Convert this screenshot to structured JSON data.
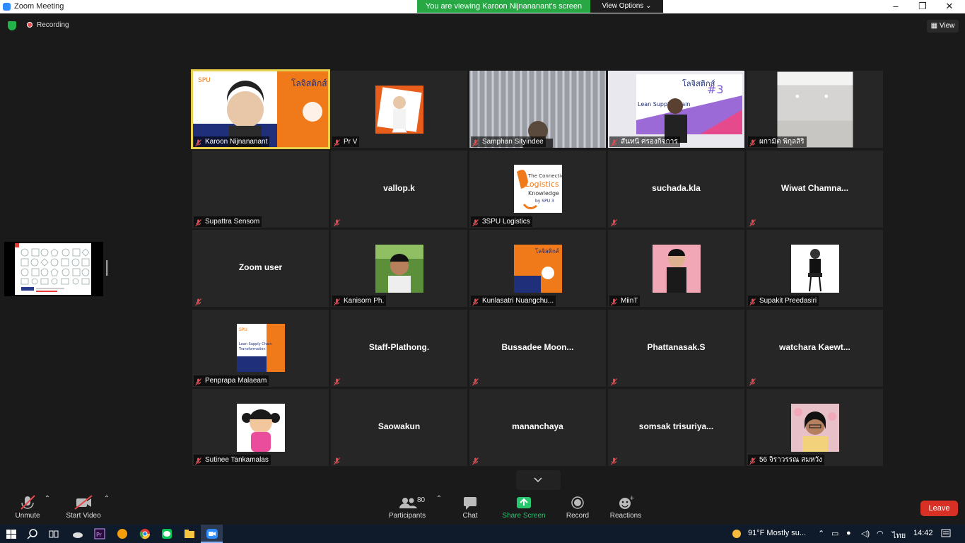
{
  "window": {
    "title": "Zoom Meeting"
  },
  "banner": {
    "viewing": "You are viewing Karoon Nijnananant's screen",
    "view_options": "View Options"
  },
  "top": {
    "recording": "Recording",
    "view": "View"
  },
  "tiles": [
    {
      "label": "Karoon Nijnananant",
      "center": "",
      "active": true
    },
    {
      "label": "Pr V",
      "center": ""
    },
    {
      "label": "Samphan Sityindee",
      "center": ""
    },
    {
      "label": "สันทนี ศรองกิจการ",
      "center": ""
    },
    {
      "label": "ผกามิต พิกุลสิริ",
      "center": ""
    },
    {
      "label": "Supattra Sensom",
      "center": ""
    },
    {
      "label": "",
      "center": "vallop.k"
    },
    {
      "label": "3SPU Logistics",
      "center": ""
    },
    {
      "label": "",
      "center": "suchada.kla"
    },
    {
      "label": "",
      "center": "Wiwat   Chamna..."
    },
    {
      "label": "",
      "center": "Zoom user"
    },
    {
      "label": "Kanisorn Ph.",
      "center": ""
    },
    {
      "label": "Kunlasatri Nuangchu...",
      "center": ""
    },
    {
      "label": "MiinT",
      "center": ""
    },
    {
      "label": "Supakit Preedasiri",
      "center": ""
    },
    {
      "label": "Penprapa Malaeam",
      "center": ""
    },
    {
      "label": "",
      "center": "Staff-Plathong."
    },
    {
      "label": "",
      "center": "Bussadee  Moon..."
    },
    {
      "label": "",
      "center": "Phattanasak.S"
    },
    {
      "label": "",
      "center": "watchara  Kaewt..."
    },
    {
      "label": "Sutinee Tankamalas",
      "center": ""
    },
    {
      "label": "",
      "center": "Saowakun"
    },
    {
      "label": "",
      "center": "mananchaya"
    },
    {
      "label": "",
      "center": "somsak  trisuriya..."
    },
    {
      "label": "56 จิราวรรณ สมหวัง",
      "center": ""
    }
  ],
  "toolbar": {
    "unmute": "Unmute",
    "start_video": "Start Video",
    "participants": "Participants",
    "participants_count": "80",
    "chat": "Chat",
    "share": "Share Screen",
    "record": "Record",
    "reactions": "Reactions",
    "leave": "Leave"
  },
  "taskbar": {
    "weather": "91°F  Mostly su...",
    "lang": "ไทย",
    "time": "14:42"
  },
  "colors": {
    "share_green": "#28a745",
    "active_outline": "#e8d04b",
    "leave_red": "#d93025",
    "mute_red": "#e5484d"
  }
}
